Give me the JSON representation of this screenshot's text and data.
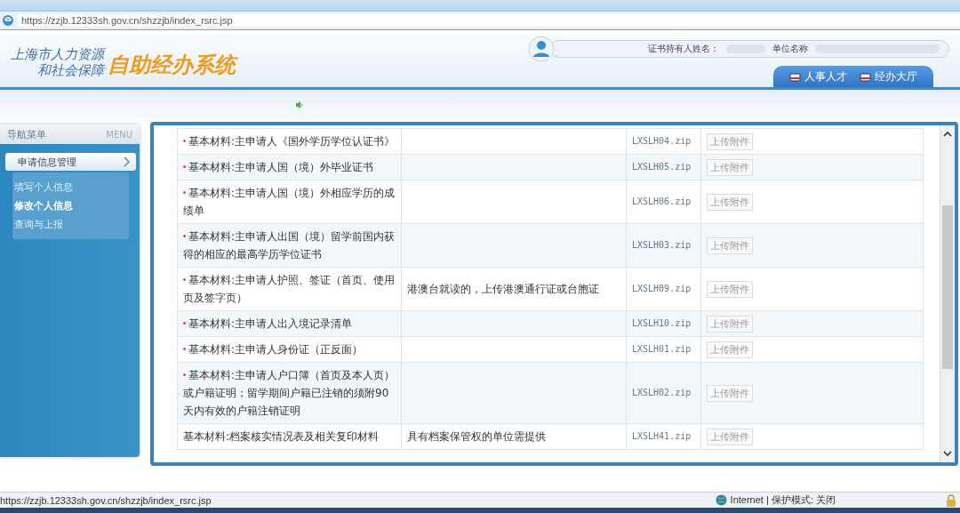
{
  "browser": {
    "url": "https://zzjb.12333sh.gov.cn/shzzjb/index_rsrc.jsp"
  },
  "header": {
    "org_line_1": "上海市人力资源",
    "org_line_2": "和社会保障",
    "system_name": "自助经办系统",
    "holder_label": "证书持有人姓名：",
    "unit_label": "单位名称",
    "tabs": [
      {
        "label": "人事人才",
        "selected": false
      },
      {
        "label": "经办大厅",
        "selected": false
      }
    ]
  },
  "sidebar": {
    "title": "导航菜单",
    "title_en": "MENU",
    "items": [
      {
        "label": "申请信息管理",
        "children": [
          {
            "label": "填写个人信息",
            "selected": false
          },
          {
            "label": "修改个人信息",
            "selected": true
          },
          {
            "label": "查询与上报",
            "selected": false
          }
        ]
      }
    ]
  },
  "table": {
    "rows": [
      {
        "material": "基本材料:主申请人《国外学历学位认证书》",
        "required": true,
        "file": "LXSLH04.zip",
        "button": "上传附件"
      },
      {
        "material": "基本材料:主申请人国（境）外毕业证书",
        "required": true,
        "file": "LXSLH05.zip",
        "button": "上传附件"
      },
      {
        "material": "基本材料:主申请人国（境）外相应学历的成绩单",
        "required": true,
        "file": "LXSLH06.zip",
        "button": "上传附件"
      },
      {
        "material": "基本材料:主申请人出国（境）留学前国内获得的相应的最高学历学位证书",
        "required": true,
        "file": "LXSLH03.zip",
        "button": "上传附件"
      },
      {
        "material": "基本材料:主申请人护照、签证（首页、使用页及签字页）",
        "required": true,
        "note": "港澳台就读的，上传港澳通行证或台胞证",
        "file": "LXSLH09.zip",
        "button": "上传附件"
      },
      {
        "material": "基本材料:主申请人出入境记录清单",
        "required": true,
        "file": "LXSLH10.zip",
        "button": "上传附件"
      },
      {
        "material": "基本材料:主申请人身份证（正反面）",
        "required": true,
        "file": "LXSLH01.zip",
        "button": "上传附件"
      },
      {
        "material": "基本材料:主申请人户口簿（首页及本人页）或户籍证明；留学期间户籍已注销的须附90天内有效的户籍注销证明",
        "required": true,
        "file": "LXSLH02.zip",
        "button": "上传附件"
      },
      {
        "material": "基本材料:档案核实情况表及相关复印材料",
        "required": false,
        "note": "具有档案保管权的单位需提供",
        "file": "LXSLH41.zip",
        "button": "上传附件"
      }
    ]
  },
  "status_bar": {
    "url": "https://zzjb.12333sh.gov.cn/shzzjb/index_rsrc.jsp",
    "zone": "Internet | 保护模式: 关闭"
  }
}
